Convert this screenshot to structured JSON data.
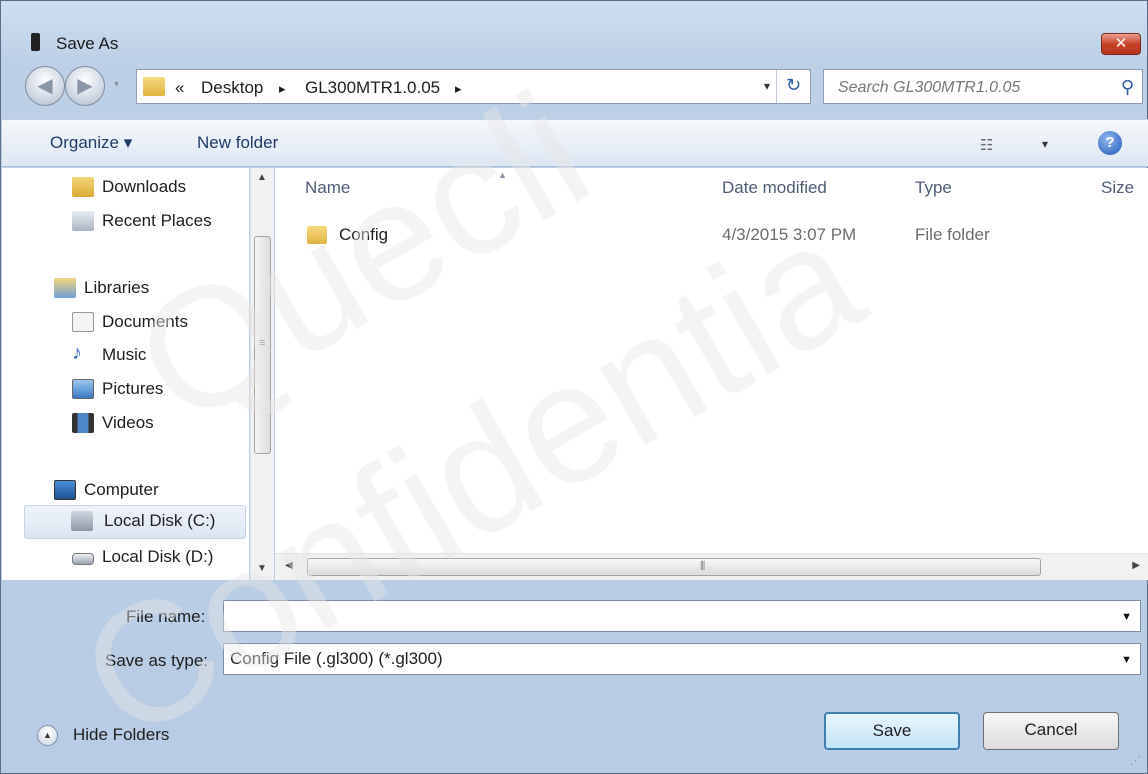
{
  "window": {
    "title": "Save As",
    "close_symbol": "✕"
  },
  "navigation": {
    "back_symbol": "◀",
    "forward_symbol": "▶",
    "dropdown_symbol": "▾"
  },
  "address": {
    "prefix": "«",
    "crumbs": [
      "Desktop",
      "GL300MTR1.0.05"
    ],
    "separator": "▸",
    "dropdown_symbol": "▾",
    "refresh_symbol": "↻"
  },
  "search": {
    "placeholder": "Search GL300MTR1.0.05"
  },
  "toolbar": {
    "organize": "Organize ▾",
    "new_folder": "New folder",
    "view_symbol": "☷",
    "help_symbol": "?"
  },
  "nav_pane": {
    "items": [
      {
        "label": "Downloads",
        "icon": "downloads-icon"
      },
      {
        "label": "Recent Places",
        "icon": "recent-places-icon"
      },
      {
        "label": "Libraries",
        "icon": "libraries-icon"
      },
      {
        "label": "Documents",
        "icon": "documents-icon"
      },
      {
        "label": "Music",
        "icon": "music-icon"
      },
      {
        "label": "Pictures",
        "icon": "pictures-icon"
      },
      {
        "label": "Videos",
        "icon": "videos-icon"
      },
      {
        "label": "Computer",
        "icon": "computer-icon"
      },
      {
        "label": "Local Disk (C:)",
        "icon": "drive-icon",
        "selected": true
      },
      {
        "label": "Local Disk (D:)",
        "icon": "drive-icon"
      }
    ]
  },
  "file_list": {
    "columns": [
      "Name",
      "Date modified",
      "Type",
      "Size"
    ],
    "rows": [
      {
        "name": "Config",
        "date_modified": "4/3/2015 3:07 PM",
        "type": "File folder",
        "size": ""
      }
    ]
  },
  "form": {
    "file_name_label": "File name:",
    "file_name_value": "",
    "save_as_type_label": "Save as type:",
    "save_as_type_value": "Config File (.gl300) (*.gl300)"
  },
  "footer": {
    "hide_folders": "Hide Folders",
    "save": "Save",
    "cancel": "Cancel"
  },
  "watermark": {
    "line1": "Quecli",
    "line2": "Confidentia"
  }
}
